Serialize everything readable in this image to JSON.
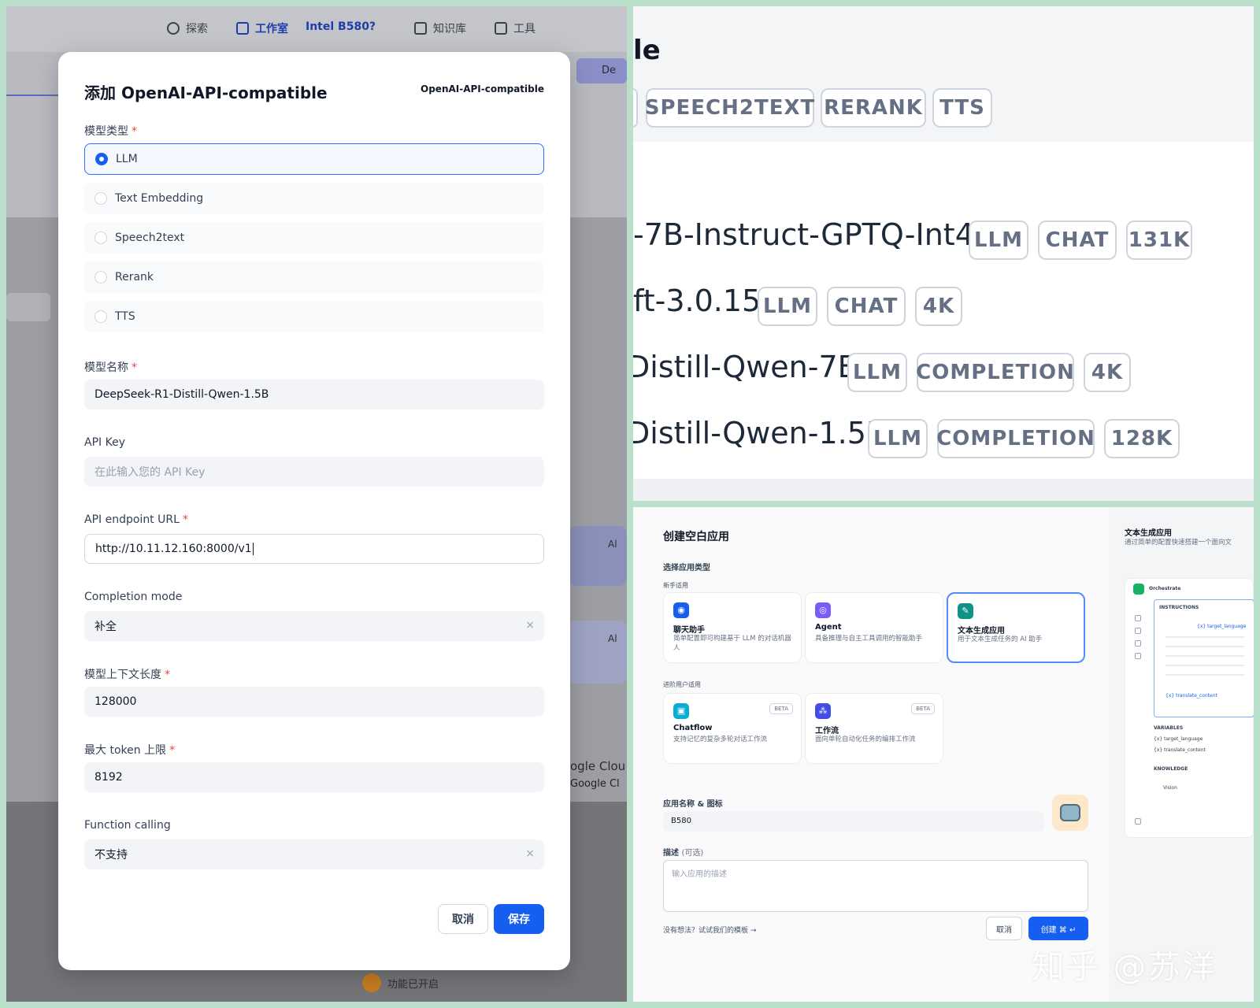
{
  "left": {
    "nav": {
      "explore": "探索",
      "studio": "工作室",
      "workspace": "Intel B580?",
      "knowledge": "知识库",
      "tools": "工具"
    },
    "bg_snippets": [
      "De",
      "Al",
      "Al",
      "ogle Clou",
      "Google Cl"
    ],
    "bottom_note": "功能已开启",
    "modal": {
      "title": "添加 OpenAI-API-compatible",
      "provider": "OpenAI-API-compatible",
      "model_type_label": "模型类型",
      "model_types": [
        {
          "label": "LLM",
          "selected": true
        },
        {
          "label": "Text Embedding",
          "selected": false
        },
        {
          "label": "Speech2text",
          "selected": false
        },
        {
          "label": "Rerank",
          "selected": false
        },
        {
          "label": "TTS",
          "selected": false
        }
      ],
      "model_name_label": "模型名称",
      "model_name_value": "DeepSeek-R1-Distill-Qwen-1.5B",
      "api_key_label": "API Key",
      "api_key_placeholder": "在此输入您的 API Key",
      "endpoint_label": "API endpoint URL",
      "endpoint_value": "http://10.11.12.160:8000/v1",
      "completion_mode_label": "Completion mode",
      "completion_mode_value": "补全",
      "context_length_label": "模型上下文长度",
      "context_length_value": "128000",
      "max_token_label": "最大 token 上限",
      "max_token_value": "8192",
      "function_calling_label": "Function calling",
      "function_calling_value": "不支持",
      "clear_symbol": "×",
      "required_mark": "*",
      "cancel": "取消",
      "save": "保存"
    }
  },
  "top_right": {
    "title_fragment": "le",
    "type_tags": [
      "SPEECH2TEXT",
      "RERANK",
      "TTS"
    ],
    "models": [
      {
        "name": "-7B-Instruct-GPTQ-Int4",
        "tags": [
          "LLM",
          "CHAT",
          "131K"
        ]
      },
      {
        "name": "ft-3.0.15",
        "tags": [
          "LLM",
          "CHAT",
          "4K"
        ]
      },
      {
        "name": "Distill-Qwen-7B",
        "tags": [
          "LLM",
          "COMPLETION",
          "4K"
        ]
      },
      {
        "name": "Distill-Qwen-1.5B",
        "tags": [
          "LLM",
          "COMPLETION",
          "128K"
        ]
      }
    ]
  },
  "bottom_right": {
    "title": "创建空白应用",
    "choose_type": "选择应用类型",
    "beginner": "新手适用",
    "advanced": "进阶用户适用",
    "apps_beginner": [
      {
        "name": "聊天助手",
        "desc": "简单配置即可构建基于 LLM 的对话机器人",
        "color": "#155eef"
      },
      {
        "name": "Agent",
        "desc": "具备推理与自主工具调用的智能助手",
        "color": "#7a5af8"
      },
      {
        "name": "文本生成应用",
        "desc": "用于文本生成任务的 AI 助手",
        "color": "#0e9384",
        "selected": true
      }
    ],
    "apps_advanced": [
      {
        "name": "Chatflow",
        "desc": "支持记忆的复杂多轮对话工作流",
        "color": "#06aed4",
        "badge": "BETA"
      },
      {
        "name": "工作流",
        "desc": "面向单轮自动化任务的编排工作流",
        "color": "#444ce7",
        "badge": "BETA"
      }
    ],
    "app_name_label": "应用名称 & 图标",
    "app_name_value": "B580",
    "desc_label": "描述",
    "desc_optional": "(可选)",
    "desc_placeholder": "输入应用的描述",
    "hint": "没有想法？试试我们的模板 →",
    "cancel": "取消",
    "create": "创建 ⌘ ↵",
    "side": {
      "title": "文本生成应用",
      "desc": "通过简单的配置快速搭建一个面向文",
      "orchestrate": "Orchestrate",
      "instructions": "INSTRUCTIONS",
      "var_target": "{x} target_language",
      "var_content": "{x} translate_content",
      "variables": "VARIABLES",
      "var1": "{x} target_language",
      "var2": "{x} translate_content",
      "knowledge": "KNOWLEDGE",
      "vision": "Vision"
    }
  },
  "watermark": "知乎 @苏洋"
}
